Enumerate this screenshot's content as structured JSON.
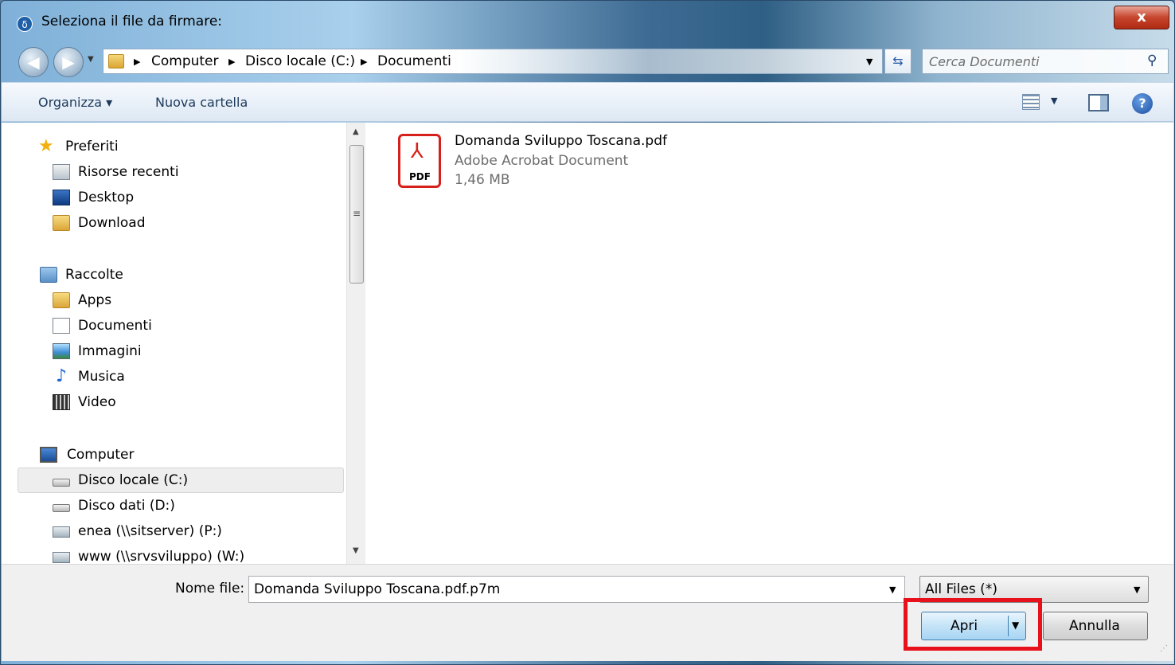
{
  "window": {
    "title": "Seleziona il file da firmare:",
    "app_icon": "δ",
    "close_label": "x"
  },
  "address_bar": {
    "breadcrumb": [
      "Computer",
      "Disco locale (C:)",
      "Documenti"
    ],
    "search_placeholder": "Cerca Documenti"
  },
  "toolbar": {
    "organize_label": "Organizza",
    "new_folder_label": "Nuova cartella"
  },
  "sidebar": {
    "favorites": {
      "label": "Preferiti",
      "items": [
        "Risorse recenti",
        "Desktop",
        "Download"
      ]
    },
    "libraries": {
      "label": "Raccolte",
      "items": [
        "Apps",
        "Documenti",
        "Immagini",
        "Musica",
        "Video"
      ]
    },
    "computer": {
      "label": "Computer",
      "items": [
        "Disco locale (C:)",
        "Disco dati (D:)",
        "enea (\\\\sitserver) (P:)",
        "www (\\\\srvsviluppo) (W:)"
      ],
      "selected": "Disco locale (C:)"
    }
  },
  "files": [
    {
      "name": "Domanda Sviluppo Toscana.pdf",
      "type": "Adobe Acrobat Document",
      "size": "1,46 MB",
      "icon": "pdf-icon",
      "icon_text": "PDF"
    }
  ],
  "footer": {
    "filename_label": "Nome file:",
    "filename_value": "Domanda Sviluppo Toscana.pdf.p7m",
    "filetype_value": "All Files  (*)",
    "open_label": "Apri",
    "cancel_label": "Annulla"
  },
  "colors": {
    "highlight": "#e8111b",
    "pdf_red": "#d6201b",
    "toolbar_text": "#1e395b"
  }
}
